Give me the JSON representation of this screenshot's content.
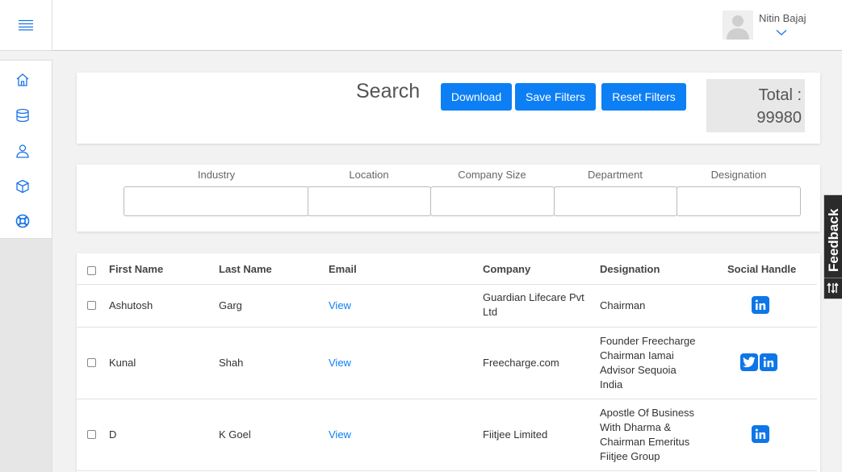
{
  "header": {
    "user_name": "Nitin Bajaj"
  },
  "sidebar": {
    "items": [
      {
        "name": "home-icon"
      },
      {
        "name": "database-icon"
      },
      {
        "name": "user-icon"
      },
      {
        "name": "box-icon"
      },
      {
        "name": "lifebuoy-icon"
      }
    ]
  },
  "search": {
    "title": "Search",
    "download_label": "Download",
    "save_label": "Save Filters",
    "reset_label": "Reset Filters",
    "total_label": "Total :",
    "total_value": "99980"
  },
  "filters": {
    "industry_label": "Industry",
    "location_label": "Location",
    "company_size_label": "Company Size",
    "department_label": "Department",
    "designation_label": "Designation"
  },
  "table": {
    "columns": [
      "First Name",
      "Last Name",
      "Email",
      "Company",
      "Designation",
      "Social Handle"
    ],
    "rows": [
      {
        "first_name": "Ashutosh",
        "last_name": "Garg",
        "email": "View",
        "company": "Guardian Lifecare Pvt Ltd",
        "designation": "Chairman",
        "social": [
          "linkedin"
        ]
      },
      {
        "first_name": "Kunal",
        "last_name": "Shah",
        "email": "View",
        "company": "Freecharge.com",
        "designation": "Founder Freecharge Chairman Iamai Advisor Sequoia India",
        "social": [
          "twitter",
          "linkedin"
        ]
      },
      {
        "first_name": "D",
        "last_name": "K Goel",
        "email": "View",
        "company": "Fiitjee Limited",
        "designation": "Apostle Of Business With Dharma & Chairman Emeritus Fiitjee Group",
        "social": [
          "linkedin"
        ]
      }
    ]
  },
  "feedback": {
    "label": "Feedback"
  },
  "colors": {
    "accent": "#0d7ff5",
    "social_blue": "#0d76e8"
  }
}
